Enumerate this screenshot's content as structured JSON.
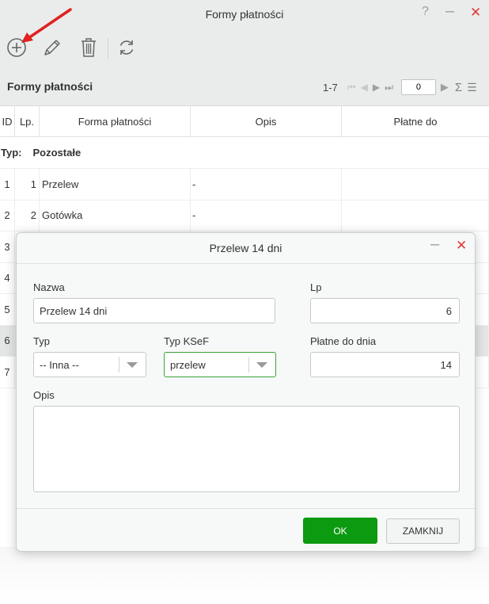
{
  "window": {
    "title": "Formy płatności",
    "help": "?",
    "minimize": "–",
    "close": "✕"
  },
  "toolbar": {
    "icons": [
      "add-icon",
      "edit-pencil-icon",
      "delete-trash-icon",
      "refresh-icon"
    ],
    "arrow_color": "#e02020"
  },
  "grid": {
    "title": "Formy płatności",
    "pager": {
      "range": "1-7",
      "page_value": "0"
    },
    "columns": [
      "ID",
      "Lp.",
      "Forma płatności",
      "Opis",
      "Płatne do"
    ],
    "group": {
      "label": "Typ:",
      "value": "Pozostałe"
    },
    "rows": [
      {
        "id": "1",
        "lp": "1",
        "forma": "Przelew",
        "opis": "-",
        "platne": ""
      },
      {
        "id": "2",
        "lp": "2",
        "forma": "Gotówka",
        "opis": "-",
        "platne": ""
      },
      {
        "id": "3",
        "lp": "",
        "forma": "",
        "opis": "",
        "platne": ""
      },
      {
        "id": "4",
        "lp": "",
        "forma": "",
        "opis": "",
        "platne": ""
      },
      {
        "id": "5",
        "lp": "",
        "forma": "",
        "opis": "",
        "platne": ""
      },
      {
        "id": "6",
        "lp": "",
        "forma": "",
        "opis": "",
        "platne": ""
      },
      {
        "id": "7",
        "lp": "",
        "forma": "",
        "opis": "",
        "platne": ""
      }
    ]
  },
  "dialog": {
    "title": "Przelew 14 dni",
    "minimize": "–",
    "close": "✕",
    "nazwa_label": "Nazwa",
    "nazwa_value": "Przelew 14 dni",
    "lp_label": "Lp",
    "lp_value": "6",
    "typ_label": "Typ",
    "typ_value": "-- Inna --",
    "ksef_label": "Typ KSeF",
    "ksef_value": "przelew",
    "platne_label": "Płatne do dnia",
    "platne_value": "14",
    "opis_label": "Opis",
    "ok_label": "OK",
    "close_label": "ZAMKNIJ"
  },
  "colors": {
    "ok_button": "#0c9a10",
    "close_icon": "#e03a3a",
    "active_select_border": "#3aa335"
  }
}
